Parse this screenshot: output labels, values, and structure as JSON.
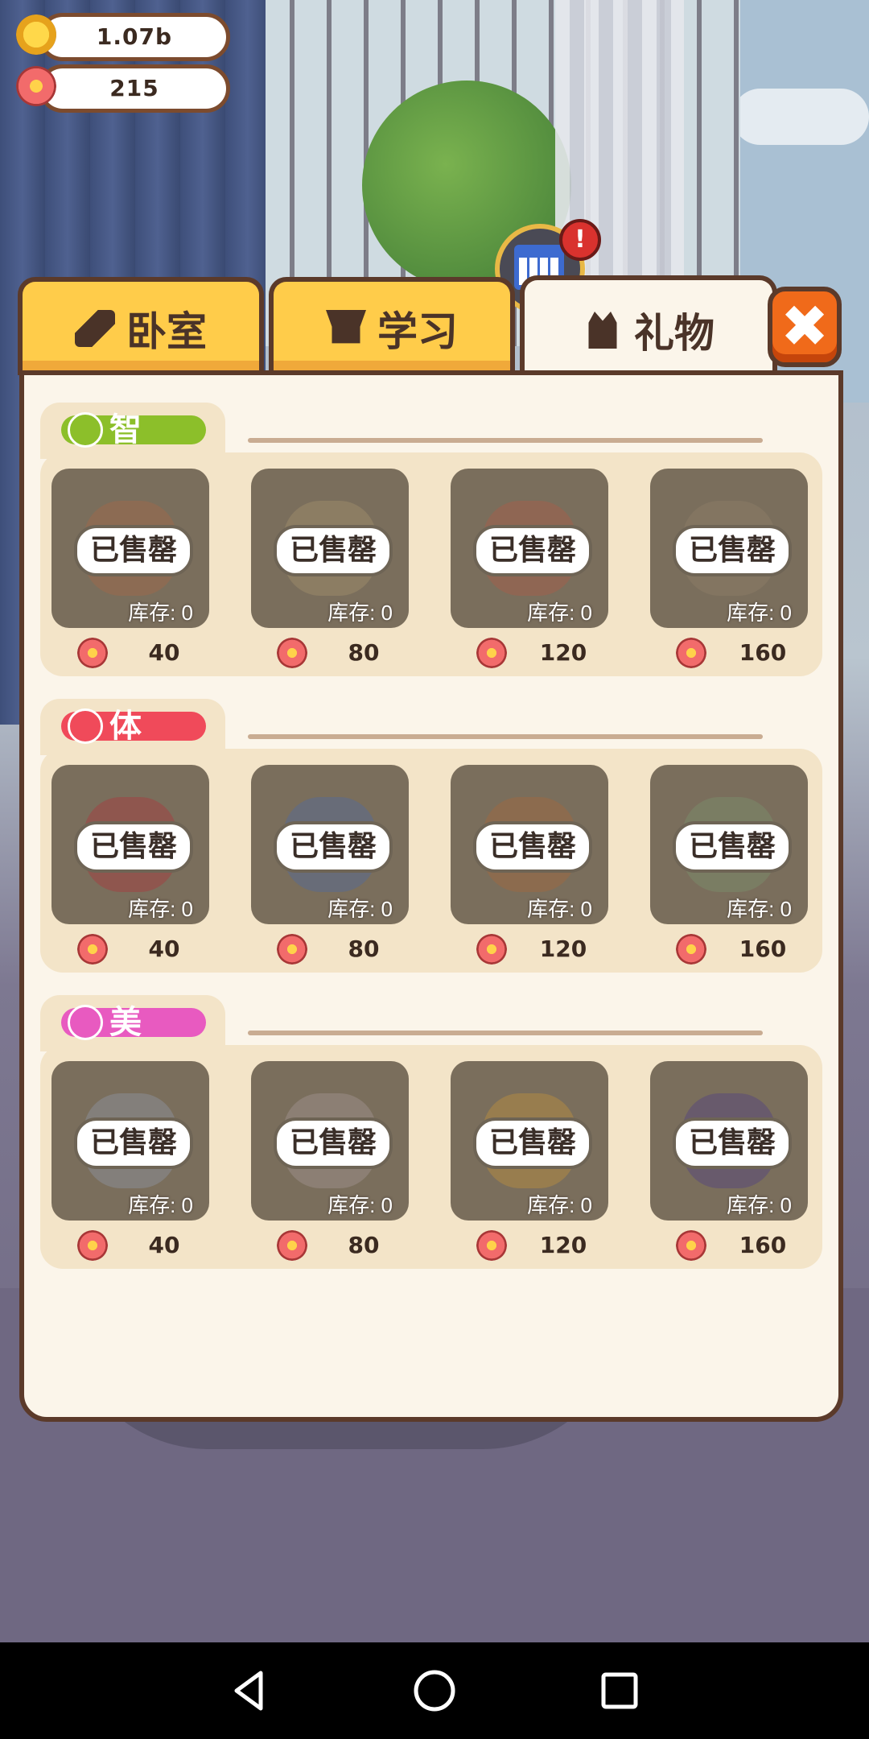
{
  "hud": {
    "coins": "1.07b",
    "flowers": "215"
  },
  "tabs": [
    {
      "label": "卧室",
      "icon": "hammer-icon",
      "active": false
    },
    {
      "label": "学习",
      "icon": "graduation-cap-icon",
      "active": false
    },
    {
      "label": "礼物",
      "icon": "gift-icon",
      "active": true
    }
  ],
  "close_label": "✖",
  "sections": [
    {
      "label": "智",
      "icon": "lightbulb-icon",
      "color": "#8cbf2a",
      "items": [
        {
          "status": "已售罄",
          "stock": "库存: 0",
          "price": "40"
        },
        {
          "status": "已售罄",
          "stock": "库存: 0",
          "price": "80"
        },
        {
          "status": "已售罄",
          "stock": "库存: 0",
          "price": "120"
        },
        {
          "status": "已售罄",
          "stock": "库存: 0",
          "price": "160"
        }
      ]
    },
    {
      "label": "体",
      "icon": "basketball-icon",
      "color": "#f04a5a",
      "items": [
        {
          "status": "已售罄",
          "stock": "库存: 0",
          "price": "40"
        },
        {
          "status": "已售罄",
          "stock": "库存: 0",
          "price": "80"
        },
        {
          "status": "已售罄",
          "stock": "库存: 0",
          "price": "120"
        },
        {
          "status": "已售罄",
          "stock": "库存: 0",
          "price": "160"
        }
      ]
    },
    {
      "label": "美",
      "icon": "music-note-icon",
      "color": "#e85ac0",
      "items": [
        {
          "status": "已售罄",
          "stock": "库存: 0",
          "price": "40"
        },
        {
          "status": "已售罄",
          "stock": "库存: 0",
          "price": "80"
        },
        {
          "status": "已售罄",
          "stock": "库存: 0",
          "price": "120"
        },
        {
          "status": "已售罄",
          "stock": "库存: 0",
          "price": "160"
        }
      ]
    }
  ]
}
